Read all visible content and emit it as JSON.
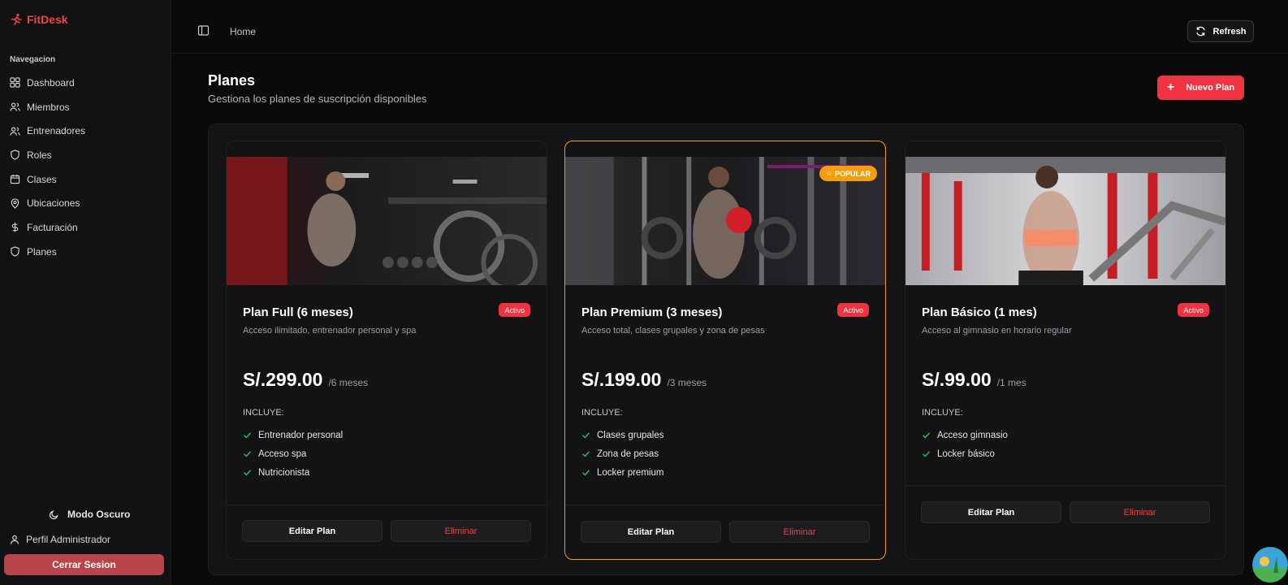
{
  "app": {
    "name": "FitDesk"
  },
  "sidebar": {
    "heading": "Navegacion",
    "items": [
      {
        "label": "Dashboard",
        "icon": "dashboard-icon"
      },
      {
        "label": "Miembros",
        "icon": "users-icon"
      },
      {
        "label": "Entrenadores",
        "icon": "users-icon"
      },
      {
        "label": "Roles",
        "icon": "shield-icon"
      },
      {
        "label": "Clases",
        "icon": "calendar-icon"
      },
      {
        "label": "Ubicaciones",
        "icon": "map-pin-icon"
      },
      {
        "label": "Facturación",
        "icon": "dollar-icon"
      },
      {
        "label": "Planes",
        "icon": "shield-icon"
      }
    ],
    "theme_toggle": "Modo Oscuro",
    "profile": "Perfil Administrador",
    "logout": "Cerrar Sesion"
  },
  "topbar": {
    "breadcrumb": "Home",
    "refresh_label": "Refresh"
  },
  "page": {
    "title": "Planes",
    "subtitle": "Gestiona los planes de suscripción disponibles",
    "new_plan_label": "Nuevo Plan"
  },
  "plans": [
    {
      "name": "Plan Full (6 meses)",
      "status": "Activo",
      "description": "Acceso ilimitado, entrenador personal y spa",
      "price": "S/.299.00",
      "period": "/6 meses",
      "includes_label": "INCLUYE:",
      "features": [
        "Entrenador personal",
        "Acceso spa",
        "Nutricionista"
      ],
      "edit_label": "Editar Plan",
      "delete_label": "Eliminar",
      "featured": false
    },
    {
      "name": "Plan Premium (3 meses)",
      "status": "Activo",
      "description": "Acceso total, clases grupales y zona de pesas",
      "price": "S/.199.00",
      "period": "/3 meses",
      "includes_label": "INCLUYE:",
      "features": [
        "Clases grupales",
        "Zona de pesas",
        "Locker premium"
      ],
      "edit_label": "Editar Plan",
      "delete_label": "Eliminar",
      "featured": true,
      "badge": "POPULAR"
    },
    {
      "name": "Plan Básico (1 mes)",
      "status": "Activo",
      "description": "Acceso al gimnasio en horario regular",
      "price": "S/.99.00",
      "period": "/1 mes",
      "includes_label": "INCLUYE:",
      "features": [
        "Acceso gimnasio",
        "Locker básico"
      ],
      "edit_label": "Editar Plan",
      "delete_label": "Eliminar",
      "featured": false
    }
  ],
  "colors": {
    "accent": "#ef3340",
    "featured_border": "#f59e0b",
    "check": "#22c55e",
    "background": "#0a0a0b"
  }
}
